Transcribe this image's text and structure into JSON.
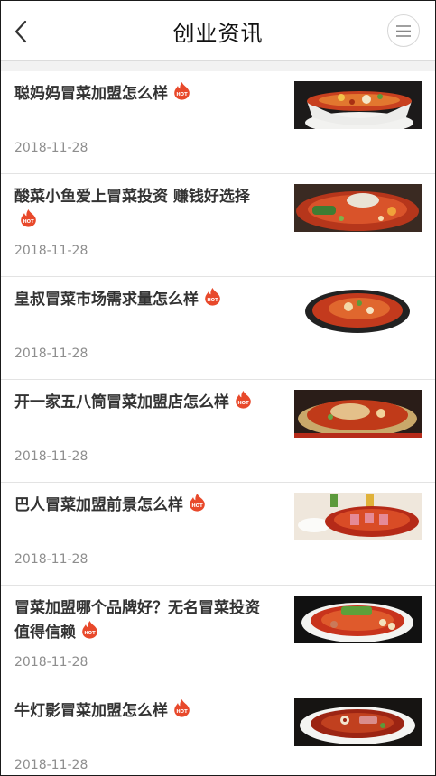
{
  "header": {
    "title": "创业资讯",
    "back_icon": "chevron-left-icon",
    "menu_icon": "menu-icon"
  },
  "articles": [
    {
      "title": "聪妈妈冒菜加盟怎么样",
      "date": "2018-11-28",
      "badge": "hot-icon"
    },
    {
      "title": "酸菜小鱼爱上冒菜投资 赚钱好选择",
      "date": "2018-11-28",
      "badge": "hot-icon"
    },
    {
      "title": "皇叔冒菜市场需求量怎么样",
      "date": "2018-11-28",
      "badge": "hot-icon"
    },
    {
      "title": "开一家五八筒冒菜加盟店怎么样",
      "date": "2018-11-28",
      "badge": "hot-icon"
    },
    {
      "title": "巴人冒菜加盟前景怎么样",
      "date": "2018-11-28",
      "badge": "hot-icon"
    },
    {
      "title": "冒菜加盟哪个品牌好？无名冒菜投资值得信赖",
      "date": "2018-11-28",
      "badge": "hot-icon"
    },
    {
      "title": "牛灯影冒菜加盟怎么样",
      "date": "2018-11-28",
      "badge": "hot-icon"
    }
  ],
  "colors": {
    "hot_badge": "#e8492b",
    "title_text": "#333333",
    "date_text": "#8e8e8e",
    "divider": "#e3e3e3"
  }
}
